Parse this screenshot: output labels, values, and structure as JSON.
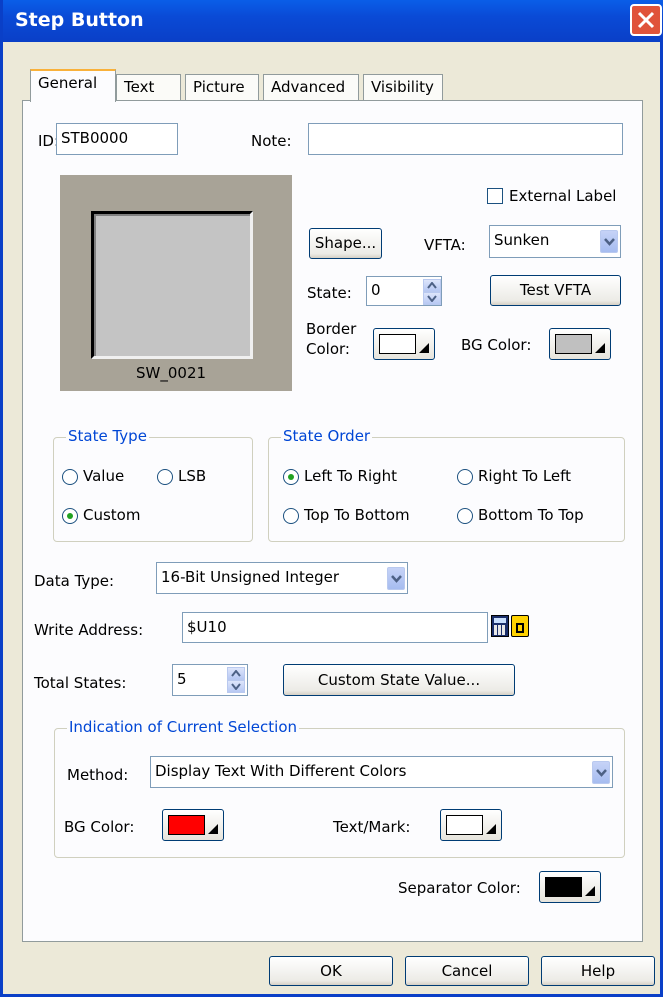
{
  "window": {
    "title": "Step Button"
  },
  "tabs": [
    "General",
    "Text",
    "Picture",
    "Advanced",
    "Visibility"
  ],
  "general": {
    "id_label": "ID:",
    "id_value": "STB0000",
    "note_label": "Note:",
    "note_value": "",
    "preview_caption": "SW_0021",
    "external_label": "External Label",
    "shape_button": "Shape...",
    "vfta_label": "VFTA:",
    "vfta_value": "Sunken",
    "state_label": "State:",
    "state_value": "0",
    "test_vfta_button": "Test VFTA",
    "border_color_label_1": "Border",
    "border_color_label_2": "Color:",
    "border_color": "#ffffff",
    "bg_color_label": "BG Color:",
    "bg_color": "#c0c0c0"
  },
  "state_type": {
    "title": "State Type",
    "options": [
      "Value",
      "LSB",
      "Custom"
    ],
    "selected": "Custom"
  },
  "state_order": {
    "title": "State Order",
    "options": [
      "Left To Right",
      "Right To Left",
      "Top To Bottom",
      "Bottom To Top"
    ],
    "selected": "Left To Right"
  },
  "data": {
    "data_type_label": "Data Type:",
    "data_type_value": "16-Bit Unsigned Integer",
    "write_address_label": "Write Address:",
    "write_address_value": "$U10",
    "total_states_label": "Total States:",
    "total_states_value": "5",
    "custom_state_button": "Custom State Value..."
  },
  "indication": {
    "title": "Indication of Current Selection",
    "method_label": "Method:",
    "method_value": "Display Text With Different Colors",
    "bg_color_label": "BG Color:",
    "bg_color": "#ff0000",
    "text_mark_label": "Text/Mark:",
    "text_mark_color": "#ffffff"
  },
  "separator": {
    "label": "Separator Color:",
    "color": "#000000"
  },
  "footer": {
    "ok": "OK",
    "cancel": "Cancel",
    "help": "Help"
  }
}
